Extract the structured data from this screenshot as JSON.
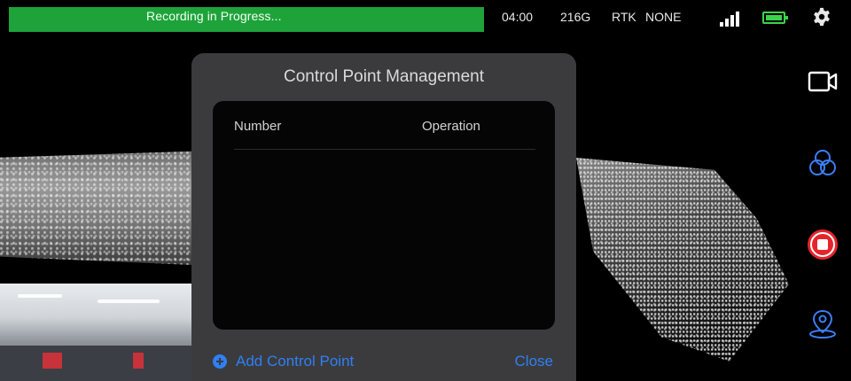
{
  "status_bar": {
    "recording_text": "Recording in Progress...",
    "time": "04:00",
    "storage": "216G",
    "rtk_label": "RTK",
    "rtk_status": "NONE",
    "recording_color": "#1ea33a",
    "battery_color": "#3bd44a",
    "icons": [
      "signal-icon",
      "battery-icon",
      "gear-icon"
    ]
  },
  "toolbar": {
    "icons": [
      "camera-icon",
      "layers-icon",
      "stop-record-icon",
      "location-pin-icon"
    ],
    "stop_color": "#e5252c"
  },
  "dialog": {
    "title": "Control Point Management",
    "columns": [
      "Number",
      "Operation"
    ],
    "rows": [],
    "add_label": "Add Control Point",
    "close_label": "Close",
    "action_color": "#2f7ff5"
  }
}
